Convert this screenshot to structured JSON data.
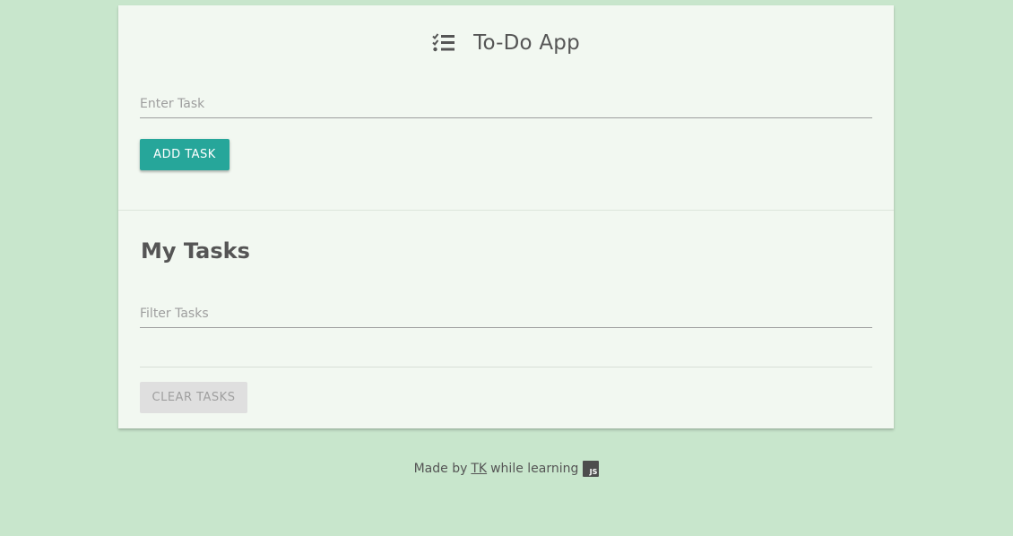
{
  "app": {
    "title": "To-Do App",
    "icon": "tasks-checklist-icon"
  },
  "task_form": {
    "input_placeholder": "Enter Task",
    "input_value": "",
    "submit_label": "ADD TASK"
  },
  "tasks_section": {
    "heading": "My Tasks",
    "filter_placeholder": "Filter Tasks",
    "filter_value": "",
    "items": [],
    "clear_label": "CLEAR TASKS"
  },
  "footer": {
    "prefix": "Made by",
    "author_link": "TK",
    "suffix": "while learning",
    "badge_text": "JS"
  },
  "colors": {
    "page_background": "#c8e6cc",
    "card_background": "#f2f8f1",
    "primary_button": "#26a69a",
    "disabled_button": "#dfdfdf",
    "text": "#555555"
  }
}
